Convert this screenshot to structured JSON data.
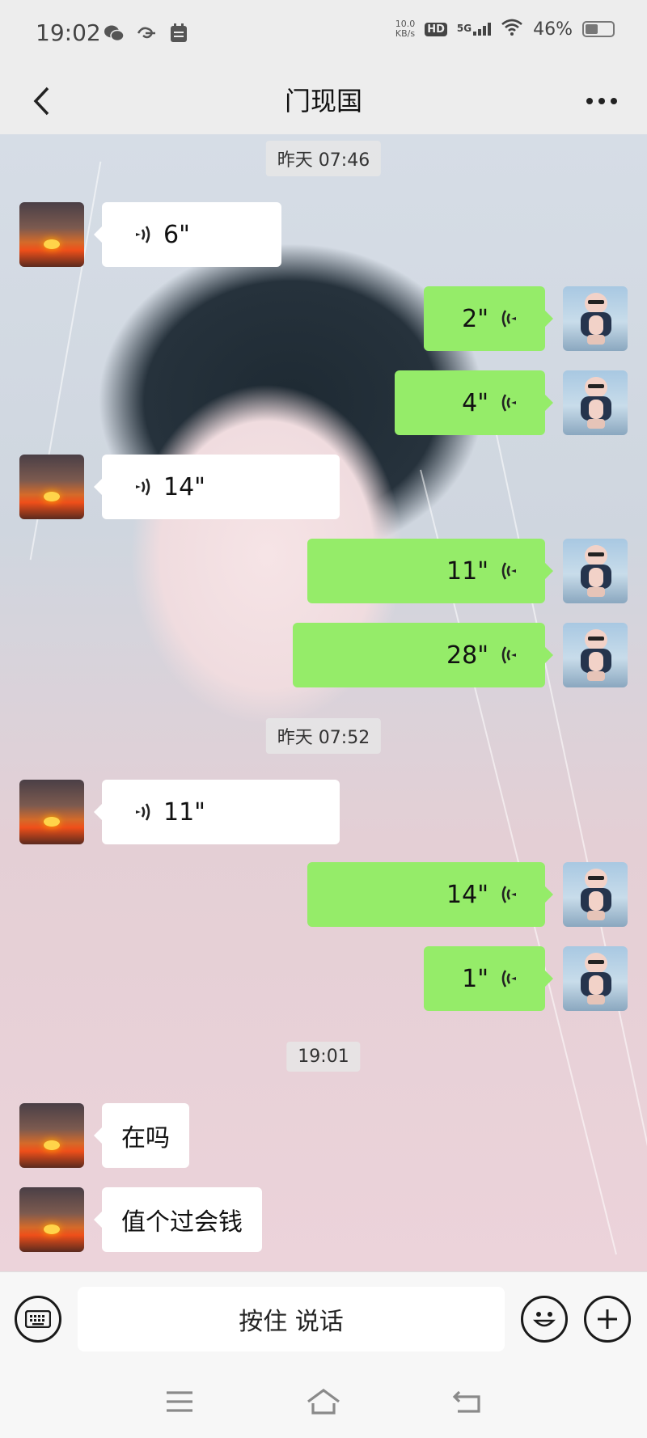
{
  "status_bar": {
    "time": "19:02",
    "left_icons": [
      "wechat-icon",
      "swirl-icon",
      "calendar-icon"
    ],
    "net_speed_value": "10.0",
    "net_speed_unit": "KB/s",
    "hd_label": "HD",
    "network": "5G",
    "battery_text": "46%",
    "battery_level": 0.46
  },
  "header": {
    "title": "门现国",
    "back_icon": "chevron-left-icon",
    "more_icon": "more-dots-icon"
  },
  "timestamps": [
    "昨天 07:46",
    "昨天 07:52",
    "19:01"
  ],
  "messages": [
    {
      "side": "left",
      "type": "voice",
      "duration": "6\""
    },
    {
      "side": "right",
      "type": "voice",
      "duration": "2\""
    },
    {
      "side": "right",
      "type": "voice",
      "duration": "4\""
    },
    {
      "side": "left",
      "type": "voice",
      "duration": "14\""
    },
    {
      "side": "right",
      "type": "voice",
      "duration": "11\""
    },
    {
      "side": "right",
      "type": "voice",
      "duration": "28\""
    },
    {
      "side": "left",
      "type": "voice",
      "duration": "11\""
    },
    {
      "side": "right",
      "type": "voice",
      "duration": "14\""
    },
    {
      "side": "right",
      "type": "voice",
      "duration": "1\""
    },
    {
      "side": "left",
      "type": "text",
      "text": "在吗"
    },
    {
      "side": "left",
      "type": "text",
      "text": "值个过会钱"
    }
  ],
  "input_bar": {
    "hold_to_talk": "按住 说话",
    "keyboard_icon": "keyboard-icon",
    "emoji_icon": "emoji-icon",
    "plus_icon": "plus-icon"
  },
  "nav_bar": {
    "icons": [
      "menu-icon",
      "home-icon",
      "back-icon"
    ]
  },
  "colors": {
    "outgoing_bubble": "#95ec69",
    "incoming_bubble": "#ffffff",
    "bar_background": "#ededed"
  }
}
